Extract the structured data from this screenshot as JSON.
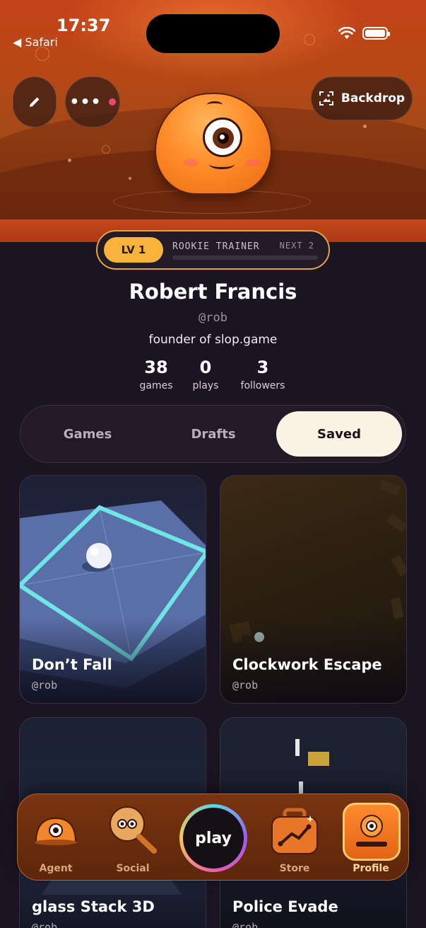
{
  "status_bar": {
    "time": "17:37",
    "back_app": "Safari"
  },
  "header": {
    "backdrop_label": "Backdrop"
  },
  "level": {
    "badge": "LV 1",
    "rank_title": "ROOKIE TRAINER",
    "next_label": "NEXT 2",
    "xp_progress": 0.0
  },
  "profile": {
    "name": "Robert Francis",
    "handle": "@rob",
    "bio": "founder of slop.game",
    "stats": [
      {
        "value": "38",
        "label": "games"
      },
      {
        "value": "0",
        "label": "plays"
      },
      {
        "value": "3",
        "label": "followers"
      }
    ]
  },
  "tabs": [
    {
      "label": "Games",
      "active": false
    },
    {
      "label": "Drafts",
      "active": false
    },
    {
      "label": "Saved",
      "active": true
    }
  ],
  "games": [
    {
      "title": "Don’t Fall",
      "author": "@rob"
    },
    {
      "title": "Clockwork Escape",
      "author": "@rob"
    },
    {
      "title": "glass Stack 3D",
      "author": "@rob"
    },
    {
      "title": "Police Evade",
      "author": "@rob"
    }
  ],
  "nav": [
    {
      "label": "Agent",
      "icon": "agent-blob-icon"
    },
    {
      "label": "Social",
      "icon": "magnifier-blob-icon"
    },
    {
      "label": "play",
      "icon": "play-button"
    },
    {
      "label": "Store",
      "icon": "suitcase-icon"
    },
    {
      "label": "Profile",
      "icon": "profile-tile-icon",
      "active": true
    }
  ],
  "colors": {
    "accent": "#f7b33b",
    "notify": "#f0456c",
    "background": "#1b1423",
    "hero": "#b84716"
  }
}
